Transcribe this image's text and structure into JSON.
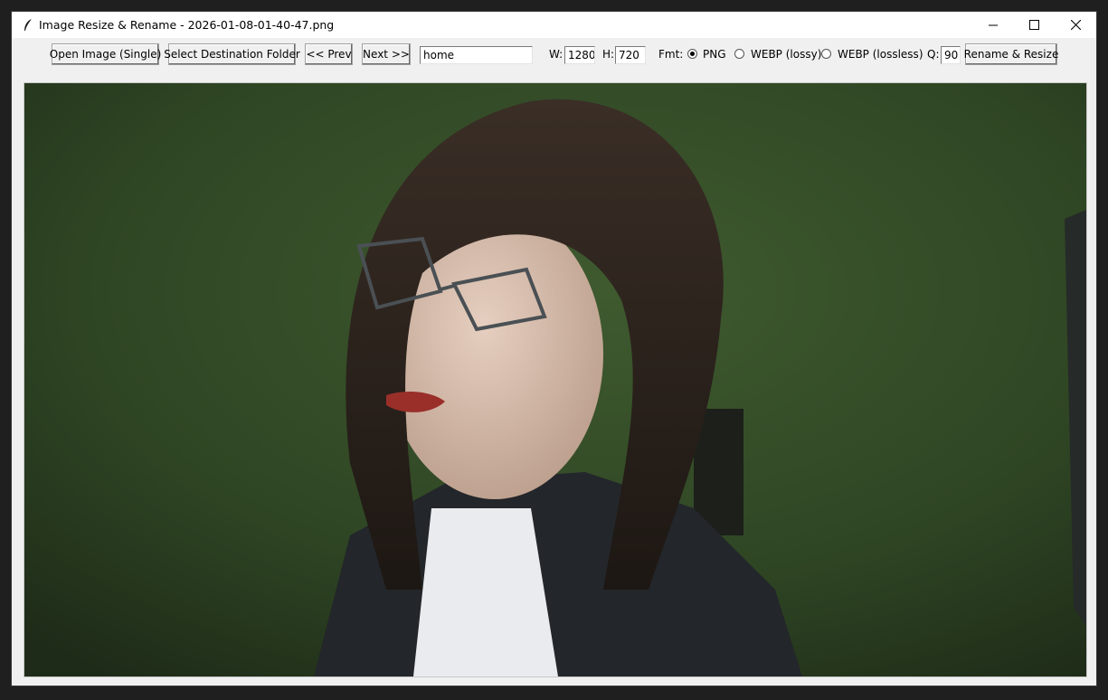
{
  "window": {
    "title": "Image Resize & Rename - 2026-01-08-01-40-47.png",
    "icon": "feather-icon",
    "controls": [
      "minimize-icon",
      "maximize-icon",
      "close-icon"
    ]
  },
  "toolbar": {
    "open_label": "Open Image (Single)",
    "dest_label": "Select Destination Folder",
    "prev_label": "<< Prev",
    "next_label": "Next >>",
    "name_value": "home",
    "w_label": "W:",
    "w_value": "1280",
    "h_label": "H:",
    "h_value": "720",
    "fmt_label": "Fmt:",
    "formats": [
      {
        "label": "PNG",
        "selected": true
      },
      {
        "label": "WEBP (lossy)",
        "selected": false
      },
      {
        "label": "WEBP (lossless)",
        "selected": false
      }
    ],
    "q_label": "Q:",
    "q_value": "90",
    "rename_label": "Rename & Resize"
  },
  "preview": {
    "description_icon": "image-preview",
    "background_color": "#2e4a26"
  }
}
